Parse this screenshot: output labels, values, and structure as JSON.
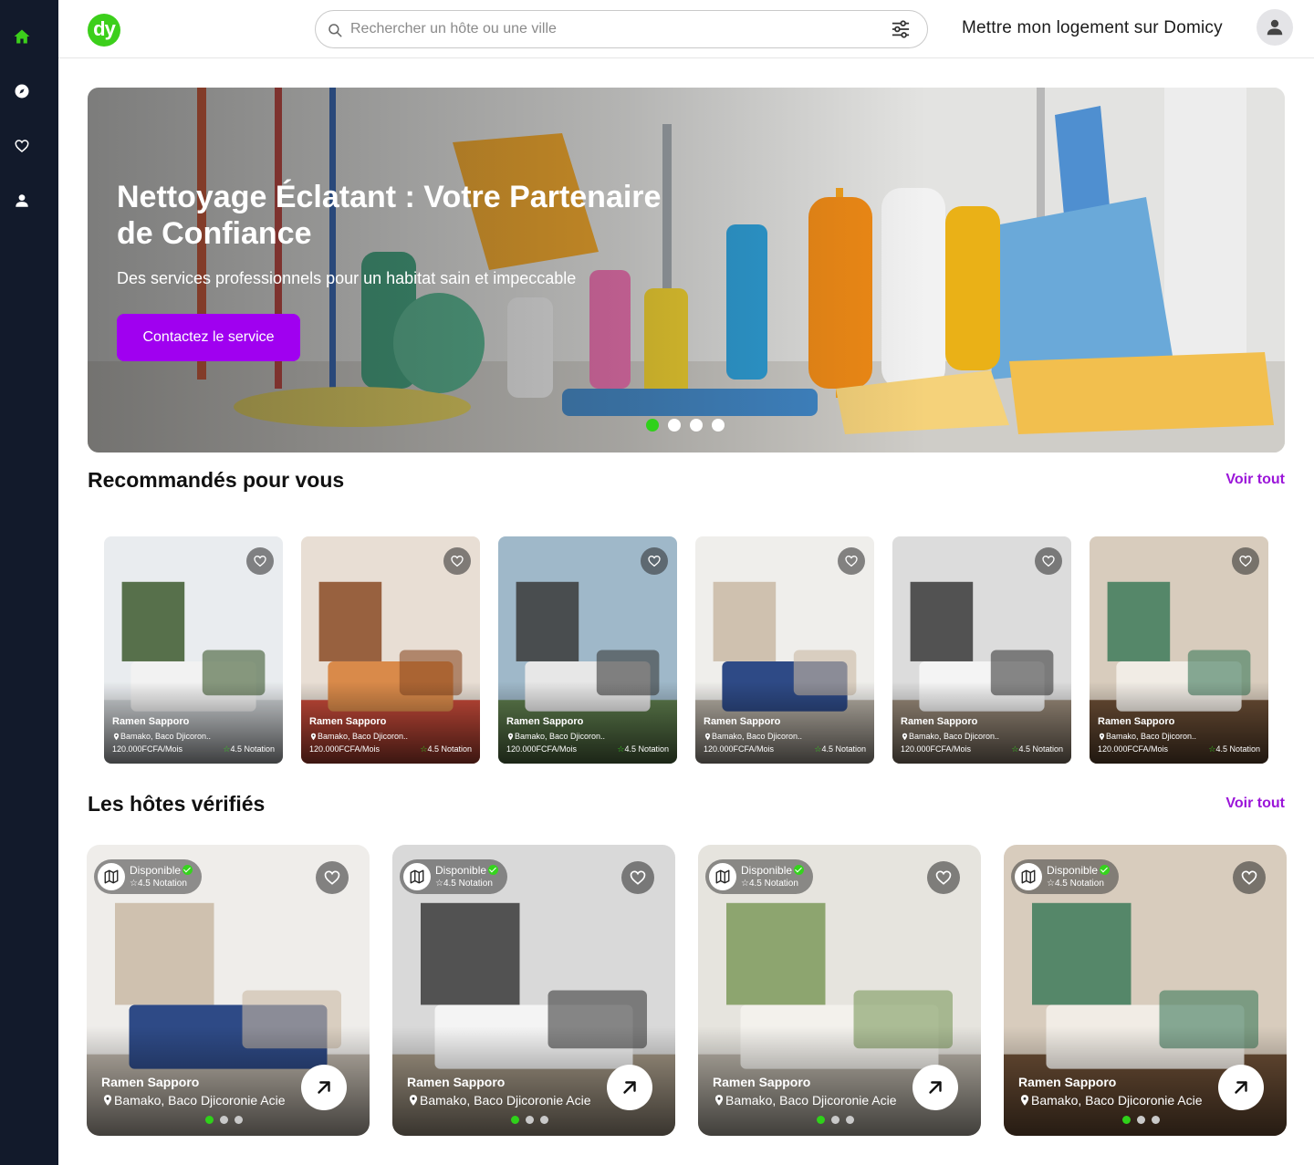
{
  "sidebar": {
    "items": [
      {
        "icon": "home-icon",
        "active": true
      },
      {
        "icon": "compass-icon",
        "active": false
      },
      {
        "icon": "heart-icon",
        "active": false
      },
      {
        "icon": "user-icon",
        "active": false
      }
    ]
  },
  "header": {
    "logo_text": "dy",
    "search_placeholder": "Rechercher un hôte ou une ville",
    "host_link": "Mettre mon logement sur Domicy"
  },
  "hero": {
    "title": "Nettoyage Éclatant : Votre Partenaire de Confiance",
    "subtitle": "Des services professionnels pour un habitat sain et impeccable",
    "cta": "Contactez le service",
    "slide_count": 4,
    "active_slide": 1
  },
  "recommended": {
    "title": "Recommandés pour vous",
    "see_all": "Voir tout",
    "cards": [
      {
        "name": "Ramen Sapporo",
        "location": "Bamako, Baco Djicoron..",
        "price": "120.000FCFA/Mois",
        "rating": "4.5 Notation"
      },
      {
        "name": "Ramen Sapporo",
        "location": "Bamako, Baco Djicoron..",
        "price": "120.000FCFA/Mois",
        "rating": "4.5 Notation"
      },
      {
        "name": "Ramen Sapporo",
        "location": "Bamako, Baco Djicoron..",
        "price": "120.000FCFA/Mois",
        "rating": "4.5 Notation"
      },
      {
        "name": "Ramen Sapporo",
        "location": "Bamako, Baco Djicoron..",
        "price": "120.000FCFA/Mois",
        "rating": "4.5 Notation"
      },
      {
        "name": "Ramen Sapporo",
        "location": "Bamako, Baco Djicoron..",
        "price": "120.000FCFA/Mois",
        "rating": "4.5 Notation"
      },
      {
        "name": "Ramen Sapporo",
        "location": "Bamako, Baco Djicoron..",
        "price": "120.000FCFA/Mois",
        "rating": "4.5 Notation"
      }
    ]
  },
  "verified_hosts": {
    "title": "Les hôtes vérifiés",
    "see_all": "Voir tout",
    "cards": [
      {
        "status": "Disponible",
        "rating": "4.5 Notation",
        "name": "Ramen Sapporo",
        "location": "Bamako, Baco Djicoronie Acie"
      },
      {
        "status": "Disponible",
        "rating": "4.5 Notation",
        "name": "Ramen Sapporo",
        "location": "Bamako, Baco Djicoronie Acie"
      },
      {
        "status": "Disponible",
        "rating": "4.5 Notation",
        "name": "Ramen Sapporo",
        "location": "Bamako, Baco Djicoronie Acie"
      },
      {
        "status": "Disponible",
        "rating": "4.5 Notation",
        "name": "Ramen Sapporo",
        "location": "Bamako, Baco Djicoronie Acie"
      }
    ]
  },
  "colors": {
    "sidebar_bg": "#121a2b",
    "brand_green": "#3ccf1b",
    "accent_purple": "#a000f0",
    "link_purple": "#9b16d9"
  }
}
